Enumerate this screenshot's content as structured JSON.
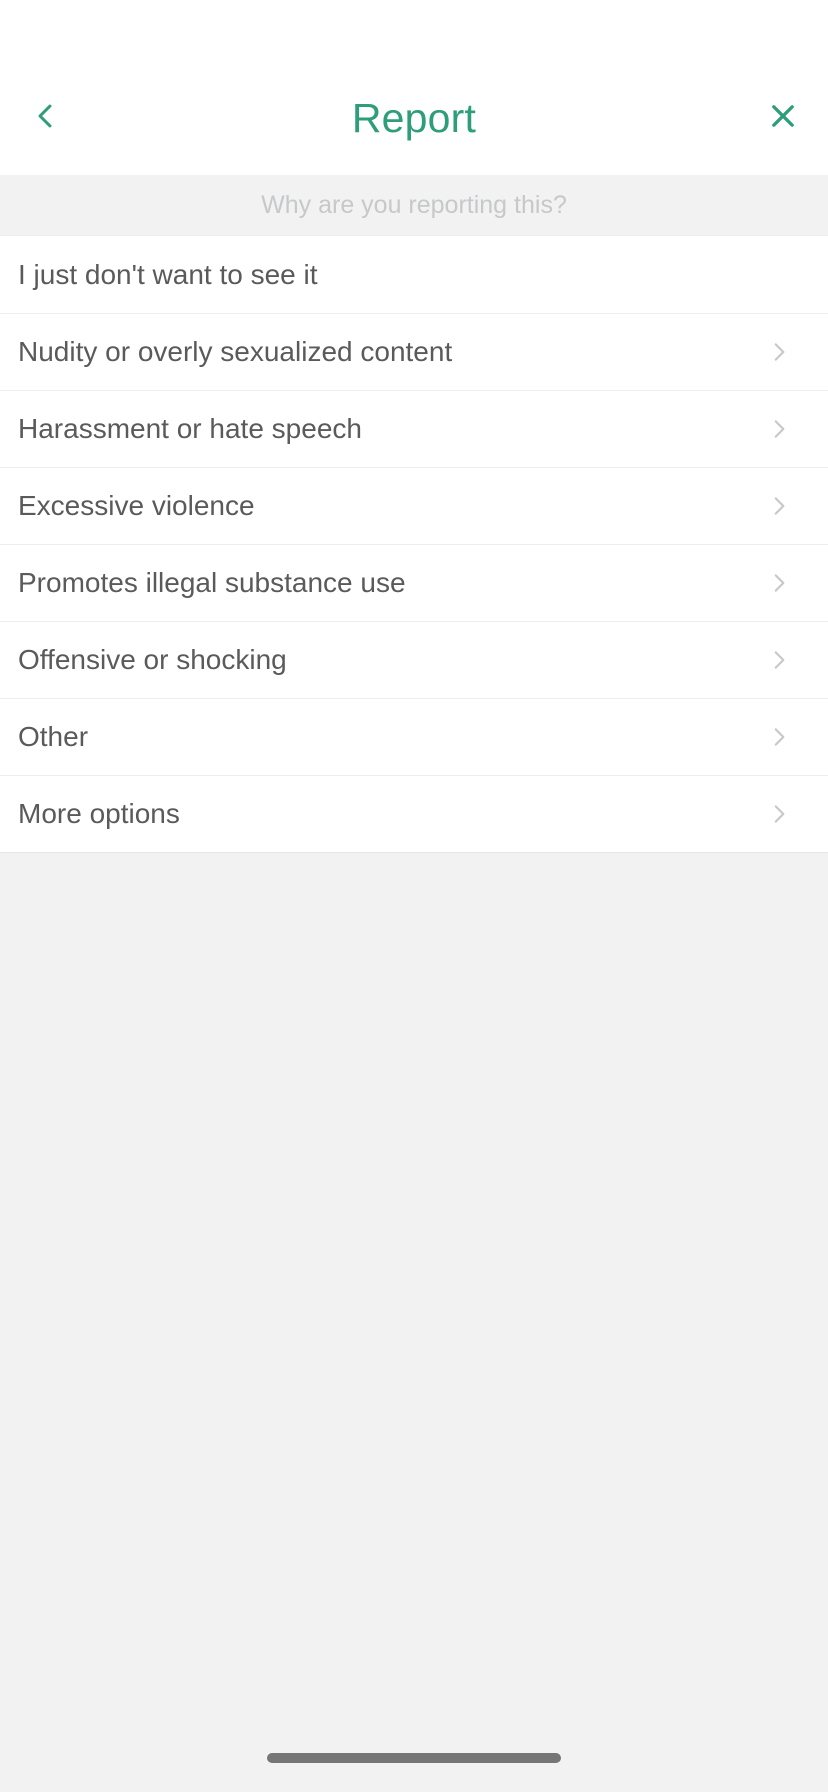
{
  "theme": {
    "accent": "#2e9e7a",
    "page_bg": "#f2f2f2",
    "row_bg": "#ffffff",
    "label_color": "#5a5a5a",
    "prompt_color": "#c6c8ca",
    "chevron_color": "#c8c8c8",
    "home_indicator_color": "#767676"
  },
  "header": {
    "title": "Report",
    "back_icon": "chevron-left-icon",
    "close_icon": "close-x-icon"
  },
  "prompt": {
    "text": "Why are you reporting this?"
  },
  "options": [
    {
      "label": "I just don't want to see it",
      "has_chevron": false,
      "chevron_icon": "chevron-right-icon"
    },
    {
      "label": "Nudity or overly sexualized content",
      "has_chevron": true,
      "chevron_icon": "chevron-right-icon"
    },
    {
      "label": "Harassment or hate speech",
      "has_chevron": true,
      "chevron_icon": "chevron-right-icon"
    },
    {
      "label": "Excessive violence",
      "has_chevron": true,
      "chevron_icon": "chevron-right-icon"
    },
    {
      "label": "Promotes illegal substance use",
      "has_chevron": true,
      "chevron_icon": "chevron-right-icon"
    },
    {
      "label": "Offensive or shocking",
      "has_chevron": true,
      "chevron_icon": "chevron-right-icon"
    },
    {
      "label": "Other",
      "has_chevron": true,
      "chevron_icon": "chevron-right-icon"
    },
    {
      "label": "More options",
      "has_chevron": true,
      "chevron_icon": "chevron-right-icon"
    }
  ],
  "system": {
    "home_indicator": "home-indicator"
  }
}
